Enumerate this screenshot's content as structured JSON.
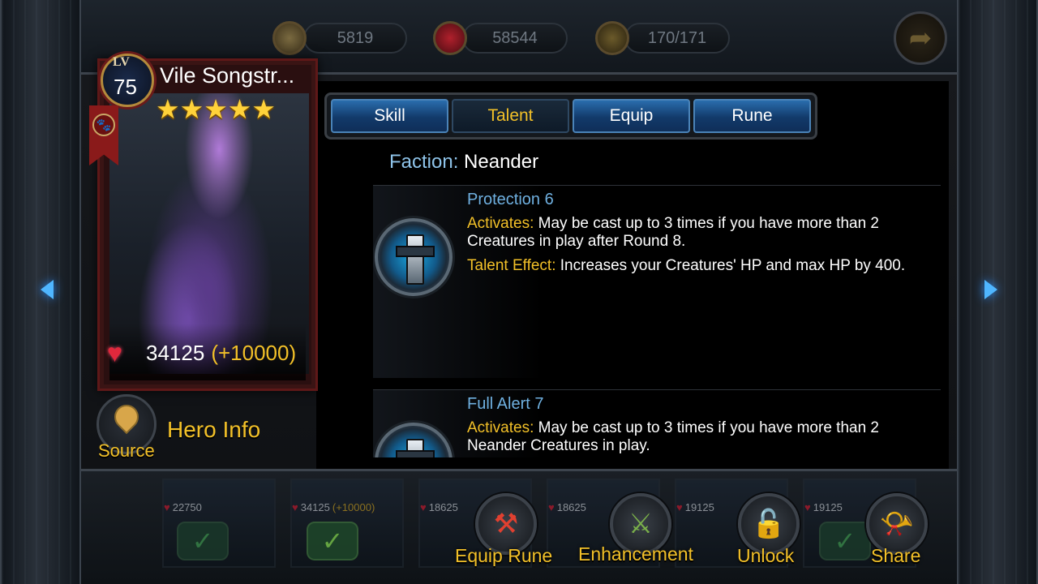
{
  "resources": {
    "value_1": "5819",
    "hp_total": "58544",
    "battle_count": "170/171"
  },
  "hero": {
    "level_label": "LV",
    "level": "75",
    "name": "Vile Songstr...",
    "stars": 5,
    "hp": "34125",
    "hp_bonus": "(+10000)"
  },
  "tabs": [
    {
      "label": "Skill",
      "active": false
    },
    {
      "label": "Talent",
      "active": true
    },
    {
      "label": "Equip",
      "active": false
    },
    {
      "label": "Rune",
      "active": false
    }
  ],
  "faction": {
    "key": "Faction:",
    "value": "Neander"
  },
  "talents": [
    {
      "title": "Protection 6",
      "activates_key": "Activates:",
      "activates_text": "May be cast up to 3 times if you have more than 2 Creatures in play after Round 8.",
      "effect_key": "Talent Effect:",
      "effect_text": "Increases your Creatures' HP and max HP by 400."
    },
    {
      "title": "Full Alert 7",
      "activates_key": "Activates:",
      "activates_text": "May be cast up to 3 times if you have more than 2 Neander Creatures in play."
    }
  ],
  "side_buttons": {
    "source": "Source",
    "hero_info": "Hero Info"
  },
  "deck_cards": [
    {
      "hp": "22750",
      "bonus": ""
    },
    {
      "hp": "34125",
      "bonus": "(+10000)"
    },
    {
      "hp": "18625",
      "bonus": ""
    },
    {
      "hp": "18625",
      "bonus": ""
    },
    {
      "hp": "19125",
      "bonus": ""
    },
    {
      "hp": "19125",
      "bonus": ""
    }
  ],
  "actions": {
    "equip_rune": "Equip Rune",
    "enhancement": "Enhancement",
    "unlock": "Unlock",
    "share": "Share"
  },
  "colors": {
    "accent_gold": "#f2c028",
    "tab_blue": "#2a6dad",
    "label_blue": "#8fc4ea",
    "heart_red": "#e0283c"
  },
  "icons": [
    "back-arrow-icon",
    "heart-icon",
    "crossed-swords-icon",
    "paw-icon",
    "star-icon",
    "map-pin-icon",
    "shield-sword-icon",
    "rune-hammer-icon",
    "enhancement-hammer-icon",
    "padlock-icon",
    "horn-icon",
    "checkmark-icon",
    "nav-left-icon",
    "nav-right-icon"
  ]
}
